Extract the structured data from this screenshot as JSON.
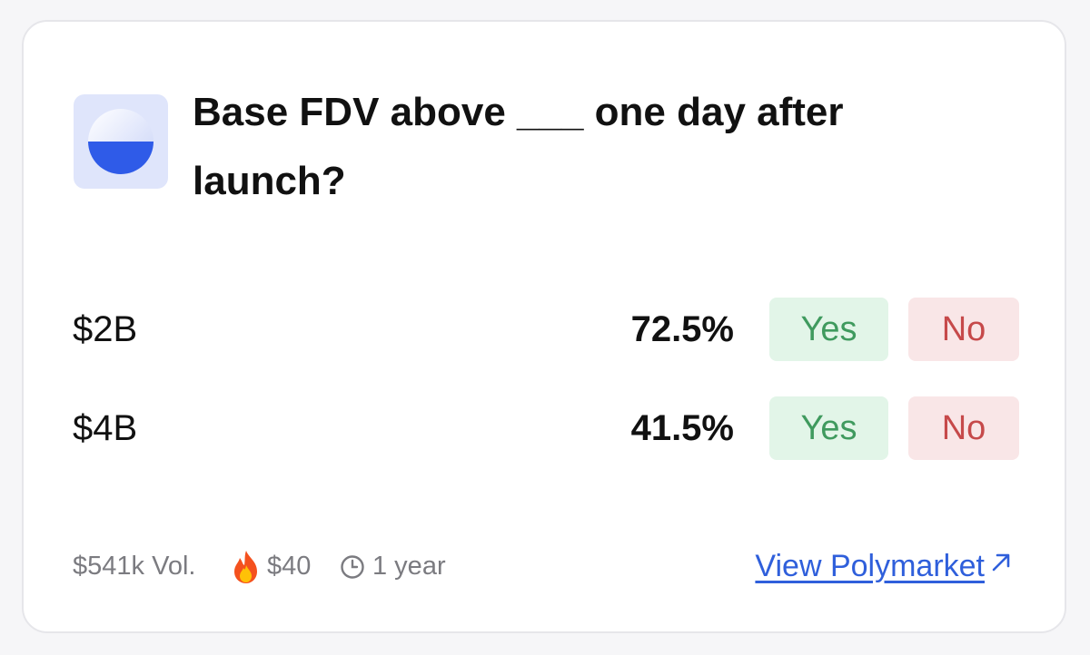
{
  "market": {
    "title": "Base FDV above ___ one day after launch?",
    "logo_icon": "base-logo-icon"
  },
  "outcomes": [
    {
      "label": "$2B",
      "probability": "72.5%",
      "yes_label": "Yes",
      "no_label": "No"
    },
    {
      "label": "$4B",
      "probability": "41.5%",
      "yes_label": "Yes",
      "no_label": "No"
    }
  ],
  "footer": {
    "volume": "$541k Vol.",
    "fire_icon": "fire-icon",
    "fee": "$40",
    "clock_icon": "clock-icon",
    "duration": "1 year",
    "link_label": "View Polymarket",
    "link_icon": "external-arrow-icon"
  },
  "colors": {
    "yes_bg": "#e2f5e8",
    "yes_text": "#3f9a5e",
    "no_bg": "#f9e6e7",
    "no_text": "#c6494a",
    "link": "#2f5fdb",
    "logo_blue": "#2f5be8"
  }
}
